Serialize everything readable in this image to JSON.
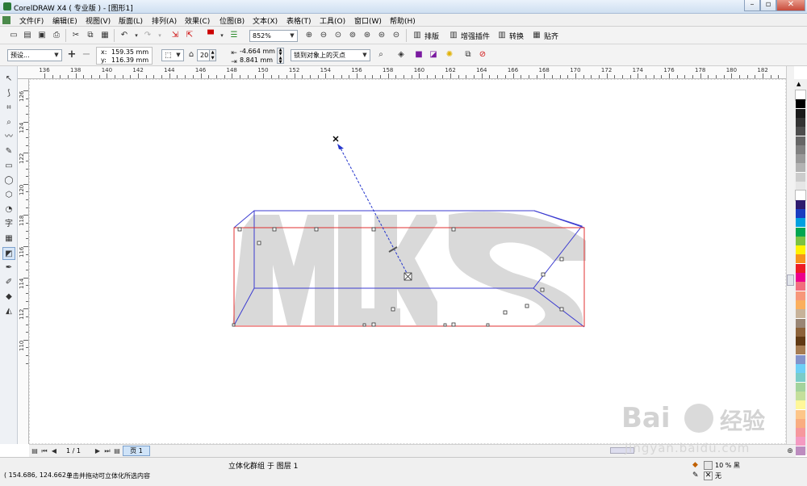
{
  "window": {
    "title": "CorelDRAW X4 ( 专业版 ) - [图形1]"
  },
  "menu": [
    "文件(F)",
    "编辑(E)",
    "视图(V)",
    "版面(L)",
    "排列(A)",
    "效果(C)",
    "位图(B)",
    "文本(X)",
    "表格(T)",
    "工具(O)",
    "窗口(W)",
    "帮助(H)"
  ],
  "toolbar1": {
    "zoom": "852%",
    "btn_layout": "排版",
    "btn_plugins": "增强插件",
    "btn_convert": "转换",
    "btn_paste": "贴齐"
  },
  "toolbar2": {
    "preset": "预设...",
    "x_label": "x:",
    "x_value": "159.35 mm",
    "y_label": "y:",
    "y_value": "116.39 mm",
    "depth": "20",
    "vp_x": "-4.664 mm",
    "vp_y": "8.841 mm",
    "vp_mode": "锁到对象上的灭点"
  },
  "ruler": {
    "top_labels": [
      "136",
      "138",
      "140",
      "142",
      "144",
      "146",
      "148",
      "150",
      "152",
      "154",
      "156",
      "158",
      "160",
      "162",
      "164",
      "166",
      "168",
      "170",
      "172",
      "174",
      "176",
      "178",
      "180",
      "182"
    ],
    "left_labels": [
      "126",
      "124",
      "122",
      "120",
      "118",
      "116",
      "114",
      "112",
      "110"
    ]
  },
  "pagebar": {
    "counter": "1 / 1",
    "page_tab": "页 1"
  },
  "status": {
    "coords": "( 154.686, 124.662 )",
    "hint": "单击并拖动可立体化所选内容",
    "selection": "立体化群组 于 图层 1",
    "fill": "10 % 黑",
    "outline": "无"
  },
  "watermark": {
    "brand": "Bai",
    "brand2": "经验",
    "url": "jingyan.baidu.com"
  },
  "palette_colors": [
    "#ffffff",
    "#000000",
    "#1a1a1a",
    "#333333",
    "#4d4d4d",
    "#666666",
    "#808080",
    "#999999",
    "#b3b3b3",
    "#cccccc",
    "#e6e6e6",
    "#ffffff",
    "#2e1a6e",
    "#1a3cc0",
    "#00a0e0",
    "#00a651",
    "#7cc242",
    "#fff200",
    "#f7941d",
    "#ed1c24",
    "#ec008c",
    "#f26d7d",
    "#f7977a",
    "#fbaf5d",
    "#c7b299",
    "#998675",
    "#8c6239",
    "#603913",
    "#a67c52",
    "#8393ca",
    "#6dcff6",
    "#7accc8",
    "#a3d39c",
    "#c4df9b",
    "#fff799",
    "#fdc689",
    "#f9ad81",
    "#f6989d",
    "#f49ac2",
    "#bd8cbf"
  ]
}
